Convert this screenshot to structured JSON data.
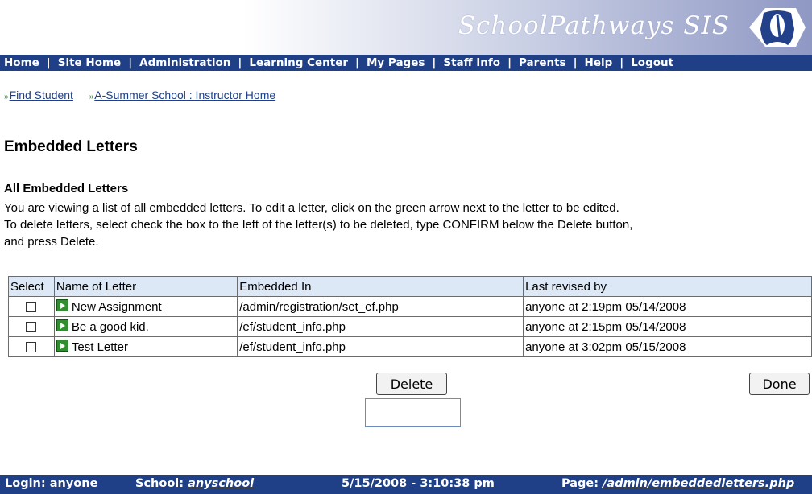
{
  "header": {
    "brand": "SchoolPathways SIS",
    "logo_icon": "open-book-logo-icon"
  },
  "nav": {
    "items": [
      "Home",
      "Site Home",
      "Administration",
      "Learning Center",
      "My Pages",
      "Staff Info",
      "Parents",
      "Help",
      "Logout"
    ],
    "separator": "|"
  },
  "breadcrumb": {
    "arrow": "»",
    "find_student": "Find Student",
    "instructor_home": "A-Summer School : Instructor Home"
  },
  "page": {
    "title": "Embedded Letters",
    "subtitle": "All Embedded Letters",
    "description": [
      "You are viewing a list of all embedded letters. To edit a letter, click on the green arrow next to the letter to be edited.",
      "To delete letters, select check the box to the left of the letter(s) to be deleted, type CONFIRM below the Delete button,",
      "and press Delete."
    ]
  },
  "table": {
    "headers": [
      "Select",
      "Name of Letter",
      "Embedded In",
      "Last revised by"
    ],
    "rows": [
      {
        "name": "New Assignment",
        "embedded_in": "/admin/registration/set_ef.php",
        "revised": "anyone at 2:19pm 05/14/2008"
      },
      {
        "name": "Be a good kid.",
        "embedded_in": "/ef/student_info.php",
        "revised": "anyone at 2:15pm 05/14/2008"
      },
      {
        "name": "Test Letter",
        "embedded_in": "/ef/student_info.php",
        "revised": "anyone at 3:02pm 05/15/2008"
      }
    ],
    "edit_icon": "green-arrow-edit-icon"
  },
  "actions": {
    "delete_label": "Delete",
    "done_label": "Done",
    "confirm_value": ""
  },
  "footer": {
    "login_label": "Login: anyone",
    "school_label": "School:",
    "school_value": "anyschool",
    "datetime": "5/15/2008 - 3:10:38 pm",
    "page_label": "Page:",
    "page_value": "/admin/embeddedletters.php"
  },
  "colors": {
    "nav_bg": "#1f3f86",
    "header_gradient_end": "#8f98c4",
    "table_header_bg": "#dde8f6",
    "edit_icon_green": "#2f8f2f"
  }
}
